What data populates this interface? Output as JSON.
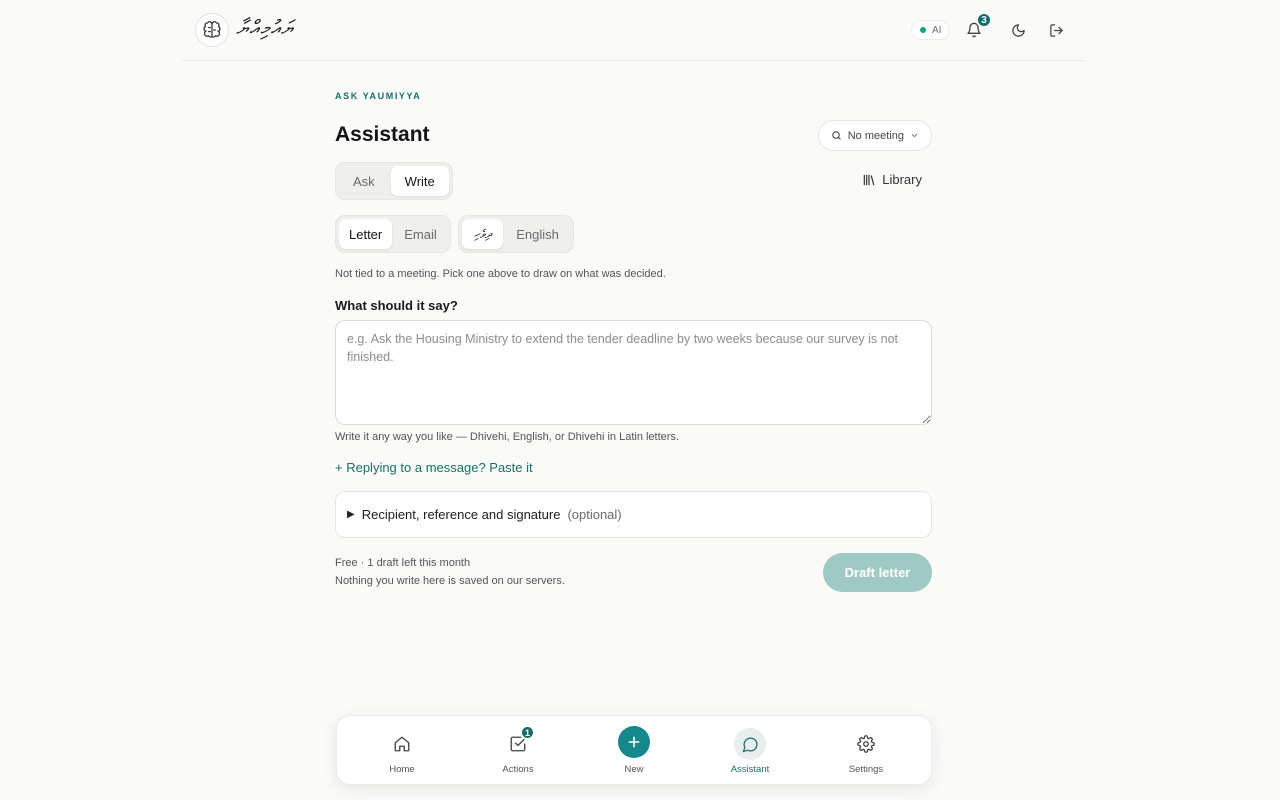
{
  "header": {
    "brand_text": "ޔައުމިއްޔާ",
    "ai_label": "AI",
    "notifications_count": "3"
  },
  "page": {
    "eyebrow": "ASK YAUMIYYA",
    "title": "Assistant",
    "meeting_selector": "No meeting"
  },
  "mode_tabs": [
    "Ask",
    "Write"
  ],
  "active_mode": "Write",
  "library_label": "Library",
  "doc_type_tabs": [
    "Letter",
    "Email"
  ],
  "language_tabs": [
    "ދިވެހި",
    "English"
  ],
  "form": {
    "note": "Not tied to a meeting. Pick one above to draw on what was decided.",
    "prompt_label": "What should it say?",
    "placeholder": "e.g. Ask the Housing Ministry to extend the tender deadline by two weeks because our survey is not finished.",
    "hint": "Write it any way you like — Dhivehi, English, or Dhivehi in Latin letters.",
    "reply_link": "+ Replying to a message? Paste it",
    "details_title": "Recipient, reference and signature",
    "details_optional": "(optional)"
  },
  "footer": {
    "plan_info": "Free · 1 draft left this month",
    "privacy_note": "Nothing you write here is saved on our servers.",
    "draft_button": "Draft letter"
  },
  "bottom_nav": {
    "items": [
      {
        "label": "Home",
        "icon": "home-icon"
      },
      {
        "label": "Actions",
        "icon": "checkbox-icon",
        "badge": "1"
      },
      {
        "label": "New",
        "icon": "plus-icon"
      },
      {
        "label": "Assistant",
        "icon": "chat-icon"
      },
      {
        "label": "Settings",
        "icon": "gear-icon"
      }
    ],
    "active": "Assistant"
  },
  "colors": {
    "accent": "#16706b",
    "draft_button_disabled": "#9fc9c4",
    "new_button": "#14888a",
    "ai_status": "#1aa37a"
  }
}
